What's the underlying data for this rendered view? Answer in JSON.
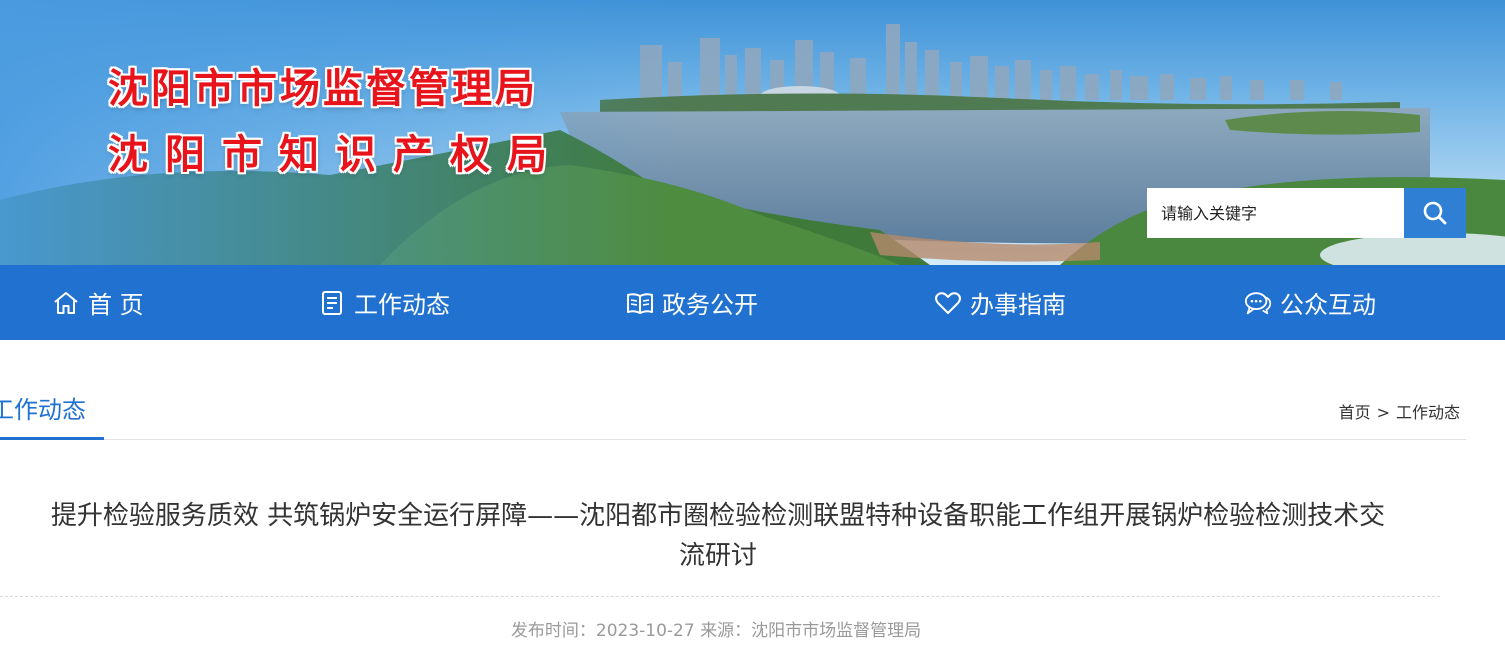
{
  "site": {
    "title_line1": "沈阳市市场监督管理局",
    "title_line2": "沈阳市知识产权局",
    "title_color": "#e8141b"
  },
  "search": {
    "placeholder": "请输入关键字",
    "button_icon": "search-icon",
    "button_color": "#2f7fd4"
  },
  "nav": {
    "background": "#2172d0",
    "items": [
      {
        "label": "首 页",
        "icon": "home-icon"
      },
      {
        "label": "工作动态",
        "icon": "document-icon"
      },
      {
        "label": "政务公开",
        "icon": "book-icon"
      },
      {
        "label": "办事指南",
        "icon": "heart-icon"
      },
      {
        "label": "公众互动",
        "icon": "chat-icon"
      }
    ]
  },
  "section": {
    "tab_label": "工作动态",
    "breadcrumb": {
      "home": "首页",
      "separator": ">",
      "current": "工作动态"
    }
  },
  "article": {
    "title": "提升检验服务质效 共筑锅炉安全运行屏障——沈阳都市圈检验检测联盟特种设备职能工作组开展锅炉检验检测技术交流研讨",
    "meta": {
      "date_label": "发布时间：",
      "date": "2023-10-27",
      "source_label": "来源：",
      "source": "沈阳市市场监督管理局"
    }
  }
}
